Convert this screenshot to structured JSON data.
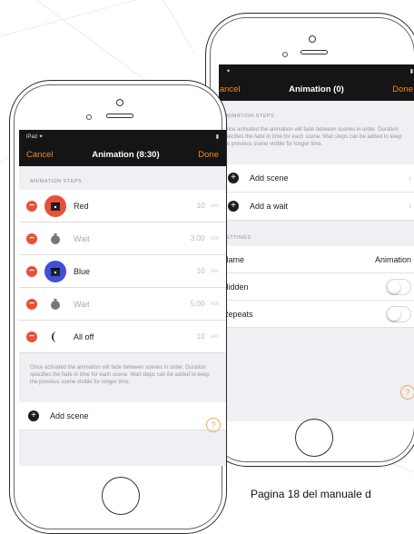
{
  "caption": "Pagina 18 del manuale d",
  "colors": {
    "accent": "#f08a24",
    "delete": "#e8503a",
    "red_scene": "#e8503a",
    "blue_scene": "#3f4fd8"
  },
  "front": {
    "status": {
      "carrier": "iPad ✦",
      "battery": "▮"
    },
    "nav": {
      "cancel": "Cancel",
      "title": "Animation (8:30)",
      "done": "Done"
    },
    "section_header": "ANIMATION STEPS",
    "steps": [
      {
        "label": "Red",
        "value": "10",
        "unit": "sec",
        "icon": "red-scene-icon"
      },
      {
        "label": "Wait",
        "value": "3:00",
        "unit": "min",
        "icon": "timer-icon"
      },
      {
        "label": "Blue",
        "value": "10",
        "unit": "sec",
        "icon": "blue-scene-icon"
      },
      {
        "label": "Wait",
        "value": "5:00",
        "unit": "min",
        "icon": "timer-icon"
      },
      {
        "label": "All off",
        "value": "10",
        "unit": "sec",
        "icon": "moon-icon"
      }
    ],
    "description": "Once activated the animation will fade between scenes in order. Duration specifies the fade in time for each scene. Wait steps can be added to keep the previous scene visible for longer time.",
    "add_scene": "Add scene"
  },
  "back": {
    "status": {
      "carrier": "✦",
      "battery": "▮"
    },
    "nav": {
      "cancel": "Cancel",
      "title": "Animation (0)",
      "done": "Done"
    },
    "section_header": "ANIMATION STEPS",
    "description": "Once activated the animation will fade between scenes in order. Duration specifies the fade in time for each scene. Wait steps can be added to keep the previous scene visible for longer time.",
    "add_scene": "Add scene",
    "add_wait": "Add a wait",
    "settings_header": "SETTINGS",
    "name_label": "Name",
    "name_value": "Animation",
    "hidden_label": "Hidden",
    "repeats_label": "Repeats",
    "help_icon": "?"
  }
}
